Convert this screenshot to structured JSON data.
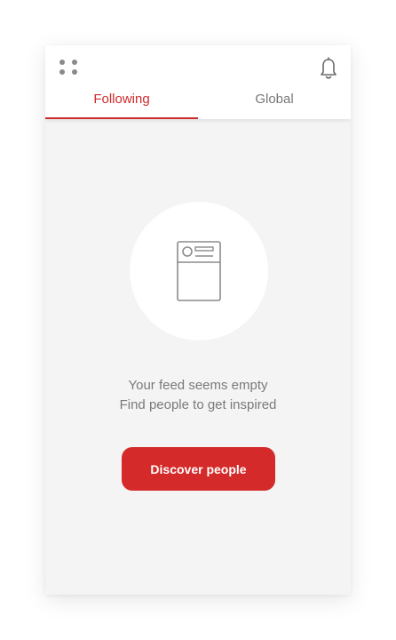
{
  "header": {
    "menu_icon": "grid-dots-icon",
    "bell_icon": "bell-icon",
    "tabs": [
      {
        "label": "Following",
        "active": true
      },
      {
        "label": "Global",
        "active": false
      }
    ]
  },
  "empty_state": {
    "icon": "feed-document-icon",
    "line1": "Your feed seems empty",
    "line2": "Find people to get inspired",
    "button_label": "Discover people"
  },
  "colors": {
    "accent": "#cf2a2a",
    "button": "#d42a2a",
    "background": "#f4f4f4"
  }
}
